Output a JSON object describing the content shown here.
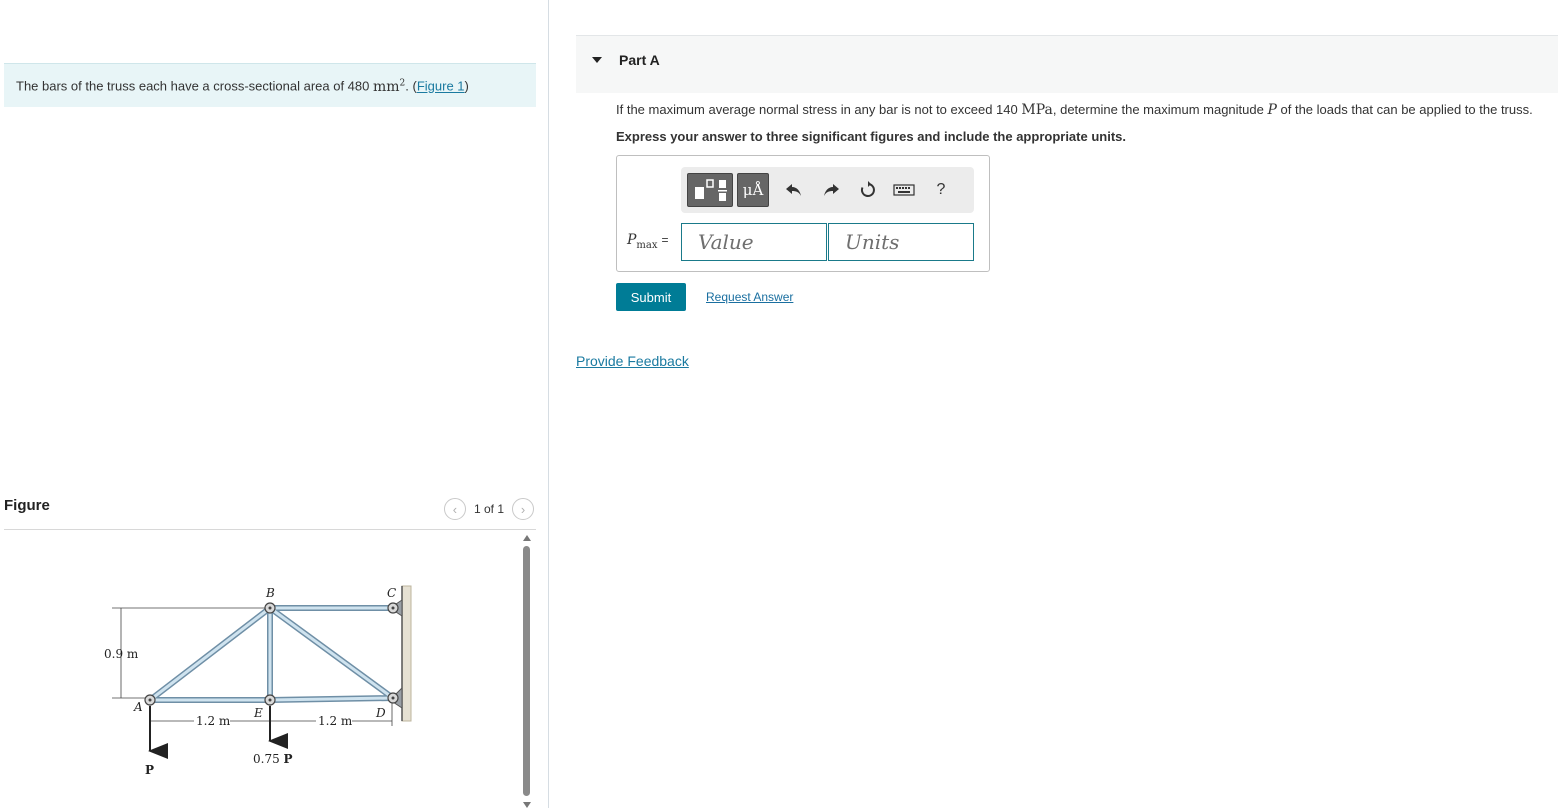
{
  "intro": {
    "text_before": "The bars of the truss each have a cross-sectional area of 480 ",
    "unit": "mm",
    "unit_exp": "2",
    "text_after": ". (",
    "figure_link": "Figure 1",
    "close": ")"
  },
  "figure": {
    "title": "Figure",
    "pager_text": "1 of 1",
    "prev_icon": "chevron-left-icon",
    "next_icon": "chevron-right-icon",
    "diagram": {
      "node_labels": {
        "A": "A",
        "B": "B",
        "C": "C",
        "D": "D",
        "E": "E"
      },
      "dim_height": "0.9 m",
      "dim_left": "1.2 m",
      "dim_right": "1.2 m",
      "load_A": "P",
      "load_E_coeff": "0.75",
      "load_E_symbol": "P"
    }
  },
  "part": {
    "title": "Part A",
    "question_before": "If the maximum average normal stress in any bar is not to exceed 140 ",
    "question_unit": "MPa",
    "question_middle": ", determine the maximum magnitude ",
    "question_symbol": "P",
    "question_after": " of the loads that can be applied to the truss.",
    "instruction": "Express your answer to three significant figures and include the appropriate units.",
    "toolbar": {
      "units_button": "μÅ",
      "template_icon": "template-icon",
      "undo_icon": "undo-icon",
      "redo_icon": "redo-icon",
      "reset_icon": "reset-icon",
      "keyboard_icon": "keyboard-icon",
      "help": "?"
    },
    "answer_label_main": "P",
    "answer_label_sub": "max",
    "answer_label_eq": "=",
    "value_placeholder": "Value",
    "units_placeholder": "Units",
    "submit": "Submit",
    "request": "Request Answer"
  },
  "feedback": "Provide Feedback"
}
